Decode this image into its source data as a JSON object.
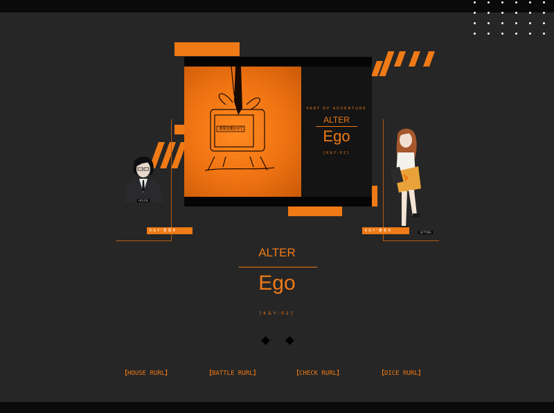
{
  "cover": {
    "subtitle": "PART OF ADVENTURE",
    "title_small": "ALTER",
    "title_large": "Ego",
    "code": "[K&Y-02]",
    "tv_sign": "意思を聞かせて"
  },
  "characters": {
    "left": {
      "tag": "K&Y'意思R.",
      "badge": "HOUSE"
    },
    "right": {
      "tag": "K&Y'番名R.",
      "badge": "SETTING"
    }
  },
  "main_title": {
    "small": "ALTER",
    "large": "Ego",
    "code": "[K&Y-02]"
  },
  "nav": [
    {
      "label": "【HOUSE RURL】"
    },
    {
      "label": "【BATTLE RURL】"
    },
    {
      "label": "【CHECK RURL】"
    },
    {
      "label": "【DICE RURL】"
    }
  ],
  "colors": {
    "accent": "#ef7a16",
    "background": "#262626",
    "dark": "#0a0a0a"
  }
}
